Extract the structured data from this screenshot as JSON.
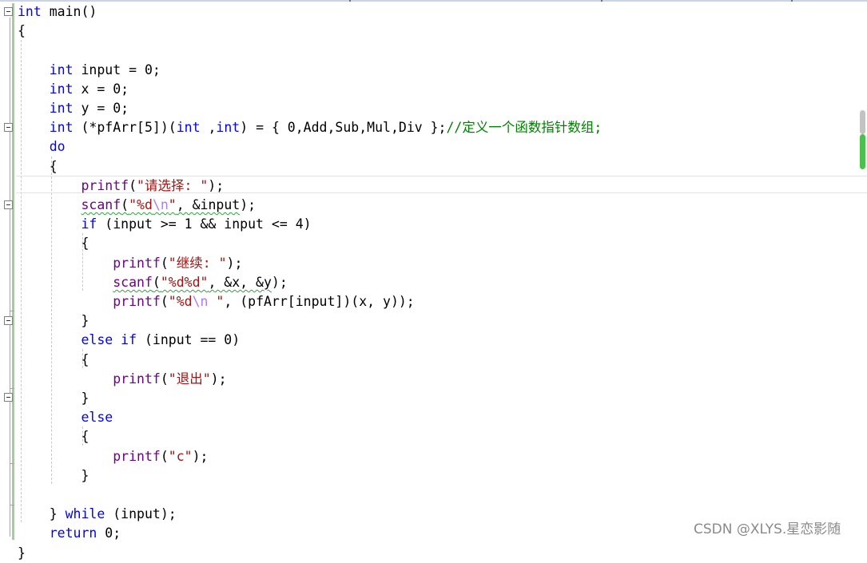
{
  "editor": {
    "lines": [
      [
        {
          "t": "int",
          "c": "kw"
        },
        {
          "t": " main()",
          "c": ""
        }
      ],
      [
        {
          "t": "{",
          "c": ""
        }
      ],
      [],
      [
        {
          "t": "    ",
          "c": ""
        },
        {
          "t": "int",
          "c": "kw"
        },
        {
          "t": " input = 0;",
          "c": ""
        }
      ],
      [
        {
          "t": "    ",
          "c": ""
        },
        {
          "t": "int",
          "c": "kw"
        },
        {
          "t": " x = 0;",
          "c": ""
        }
      ],
      [
        {
          "t": "    ",
          "c": ""
        },
        {
          "t": "int",
          "c": "kw"
        },
        {
          "t": " y = 0;",
          "c": ""
        }
      ],
      [
        {
          "t": "    ",
          "c": ""
        },
        {
          "t": "int",
          "c": "kw"
        },
        {
          "t": " (*pfArr[5])(",
          "c": ""
        },
        {
          "t": "int",
          "c": "kw"
        },
        {
          "t": " ,",
          "c": ""
        },
        {
          "t": "int",
          "c": "kw"
        },
        {
          "t": ") = { 0,Add,Sub,Mul,Div };",
          "c": ""
        },
        {
          "t": "//定义一个函数指针数组;",
          "c": "cm"
        }
      ],
      [
        {
          "t": "    ",
          "c": ""
        },
        {
          "t": "do",
          "c": "kw"
        }
      ],
      [
        {
          "t": "    {",
          "c": ""
        }
      ],
      [
        {
          "t": "        ",
          "c": ""
        },
        {
          "t": "printf",
          "c": "fn"
        },
        {
          "t": "(",
          "c": ""
        },
        {
          "t": "\"请选择: \"",
          "c": "str"
        },
        {
          "t": ");",
          "c": ""
        }
      ],
      [
        {
          "t": "        ",
          "c": ""
        },
        {
          "t": "scanf",
          "c": "fn squig"
        },
        {
          "t": "(",
          "c": "squig"
        },
        {
          "t": "\"%d",
          "c": "str squig"
        },
        {
          "t": "\\n",
          "c": "esc squig"
        },
        {
          "t": "\"",
          "c": "str squig"
        },
        {
          "t": ", &input",
          "c": "squig"
        },
        {
          "t": ");",
          "c": ""
        }
      ],
      [
        {
          "t": "        ",
          "c": ""
        },
        {
          "t": "if",
          "c": "kw"
        },
        {
          "t": " (input >= 1 && input <= 4)",
          "c": ""
        }
      ],
      [
        {
          "t": "        {",
          "c": ""
        }
      ],
      [
        {
          "t": "            ",
          "c": ""
        },
        {
          "t": "printf",
          "c": "fn"
        },
        {
          "t": "(",
          "c": ""
        },
        {
          "t": "\"继续: \"",
          "c": "str"
        },
        {
          "t": ");",
          "c": ""
        }
      ],
      [
        {
          "t": "            ",
          "c": ""
        },
        {
          "t": "scanf",
          "c": "fn squig"
        },
        {
          "t": "(",
          "c": "squig"
        },
        {
          "t": "\"%d%d\"",
          "c": "str squig"
        },
        {
          "t": ", &x, &y",
          "c": "squig"
        },
        {
          "t": ");",
          "c": ""
        }
      ],
      [
        {
          "t": "            ",
          "c": ""
        },
        {
          "t": "printf",
          "c": "fn"
        },
        {
          "t": "(",
          "c": ""
        },
        {
          "t": "\"%d",
          "c": "str"
        },
        {
          "t": "\\n",
          "c": "esc"
        },
        {
          "t": " \"",
          "c": "str"
        },
        {
          "t": ", (pfArr[input])(x, y));",
          "c": ""
        }
      ],
      [
        {
          "t": "        }",
          "c": ""
        }
      ],
      [
        {
          "t": "        ",
          "c": ""
        },
        {
          "t": "else if",
          "c": "kw"
        },
        {
          "t": " (input == 0)",
          "c": ""
        }
      ],
      [
        {
          "t": "        {",
          "c": ""
        }
      ],
      [
        {
          "t": "            ",
          "c": ""
        },
        {
          "t": "printf",
          "c": "fn"
        },
        {
          "t": "(",
          "c": ""
        },
        {
          "t": "\"退出\"",
          "c": "str"
        },
        {
          "t": ");",
          "c": ""
        }
      ],
      [
        {
          "t": "        }",
          "c": ""
        }
      ],
      [
        {
          "t": "        ",
          "c": ""
        },
        {
          "t": "else",
          "c": "kw"
        }
      ],
      [
        {
          "t": "        {",
          "c": ""
        }
      ],
      [
        {
          "t": "            ",
          "c": ""
        },
        {
          "t": "printf",
          "c": "fn"
        },
        {
          "t": "(",
          "c": ""
        },
        {
          "t": "\"c\"",
          "c": "str"
        },
        {
          "t": ");",
          "c": ""
        }
      ],
      [
        {
          "t": "        }",
          "c": ""
        }
      ],
      [],
      [
        {
          "t": "    } ",
          "c": ""
        },
        {
          "t": "while",
          "c": "kw"
        },
        {
          "t": " (input);",
          "c": ""
        }
      ],
      [
        {
          "t": "    ",
          "c": ""
        },
        {
          "t": "return",
          "c": "kw"
        },
        {
          "t": " 0;",
          "c": ""
        }
      ],
      [
        {
          "t": "}",
          "c": ""
        }
      ]
    ]
  },
  "colors": {
    "keyword": "#0000ff",
    "function": "#6f008a",
    "string": "#a31515",
    "escape": "#b776fb",
    "comment": "#008000",
    "squiggle": "#2ea43a"
  },
  "watermark": "CSDN @XLYS.星恋影随"
}
